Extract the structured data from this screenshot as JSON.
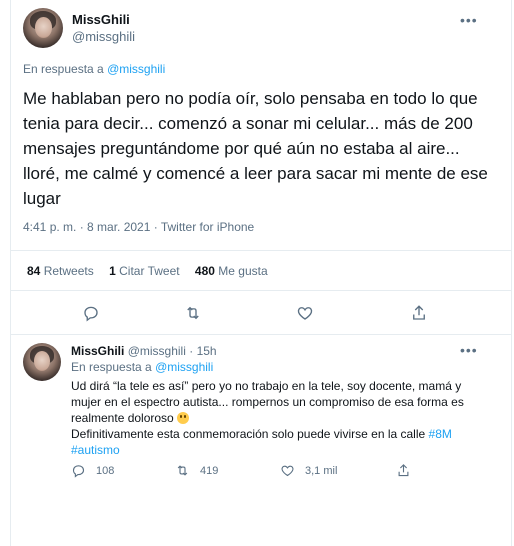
{
  "main_tweet": {
    "author_name": "MissGhili",
    "author_handle": "@missghili",
    "reply_prefix": "En respuesta a",
    "reply_handle": "@missghili",
    "text": "Me hablaban pero no podía oír, solo pensaba en todo lo que tenia para decir... comenzó a sonar mi celular... más de 200 mensajes preguntándome por qué aún no estaba al aire... lloré, me calmé y comencé a leer para sacar mi mente de ese lugar",
    "timestamp": "4:41 p. m. · 8 mar. 2021 · Twitter for iPhone",
    "stats": {
      "retweets_count": "84",
      "retweets_label": "Retweets",
      "quotes_count": "1",
      "quotes_label": "Citar Tweet",
      "likes_count": "480",
      "likes_label": "Me gusta"
    },
    "more_label": "•••"
  },
  "reply_tweet": {
    "author_name": "MissGhili",
    "author_handle": "@missghili",
    "age": "· 15h",
    "reply_prefix": "En respuesta a",
    "reply_handle": "@missghili",
    "text_part1": "Ud dirá “la tele es así” pero yo no trabajo en la tele, soy docente, mamá y mujer en el espectro autista... rompernos un compromiso de esa forma es realmente doloroso",
    "text_part2": "Definitivamente esta conmemoración solo puede vivirse en la calle",
    "hashtag1": "#8M",
    "hashtag2": "#autismo",
    "reply_count": "108",
    "retweet_count": "419",
    "like_count": "3,1 mil",
    "more_label": "•••"
  },
  "colors": {
    "accent": "#1da1f2",
    "secondary_text": "#5b7083",
    "border": "#e6ecf0"
  }
}
